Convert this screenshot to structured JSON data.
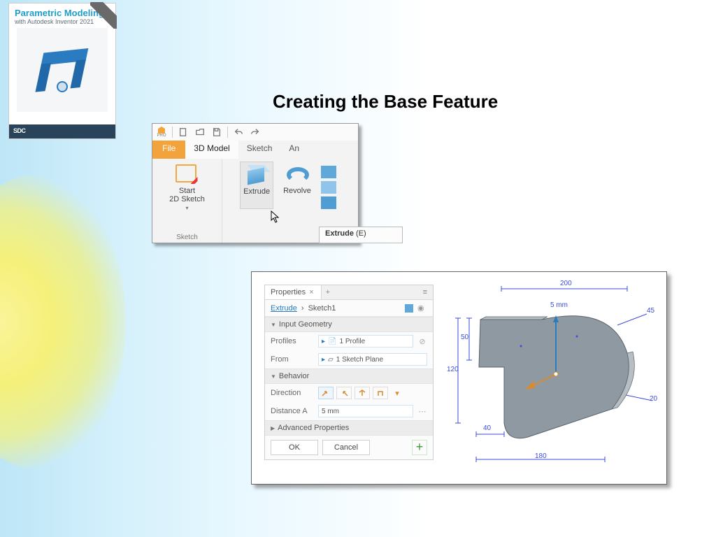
{
  "slide": {
    "title": "Creating the Base Feature"
  },
  "book": {
    "title": "Parametric Modeling",
    "subtitle": "with Autodesk Inventor 2021",
    "publisher": "SDC"
  },
  "ribbon": {
    "qat_logo": "PRO",
    "tabs": {
      "file": "File",
      "model3d": "3D Model",
      "sketch": "Sketch",
      "annotate": "An"
    },
    "sketch_panel": {
      "button": "Start\n2D Sketch",
      "drop": "▾",
      "title": "Sketch"
    },
    "create_panel": {
      "extrude": "Extrude",
      "revolve": "Revolve"
    },
    "tooltip": {
      "name": "Extrude",
      "key": "(E)"
    }
  },
  "properties": {
    "tab": "Properties",
    "breadcrumb": {
      "feature": "Extrude",
      "sep": "›",
      "sketch": "Sketch1"
    },
    "sections": {
      "input": "Input Geometry",
      "behavior": "Behavior",
      "advanced": "Advanced Properties"
    },
    "rows": {
      "profiles_label": "Profiles",
      "profiles_value": "1 Profile",
      "from_label": "From",
      "from_value": "1 Sketch Plane",
      "direction_label": "Direction",
      "distance_label": "Distance A",
      "distance_value": "5 mm"
    },
    "actions": {
      "ok": "OK",
      "cancel": "Cancel"
    }
  },
  "model": {
    "callout": "5 mm",
    "dims": {
      "top": "200",
      "left_a": "50",
      "left_b": "120",
      "bottom_a": "40",
      "bottom_b": "180",
      "r_upper": "45",
      "r_lower": "20"
    }
  }
}
